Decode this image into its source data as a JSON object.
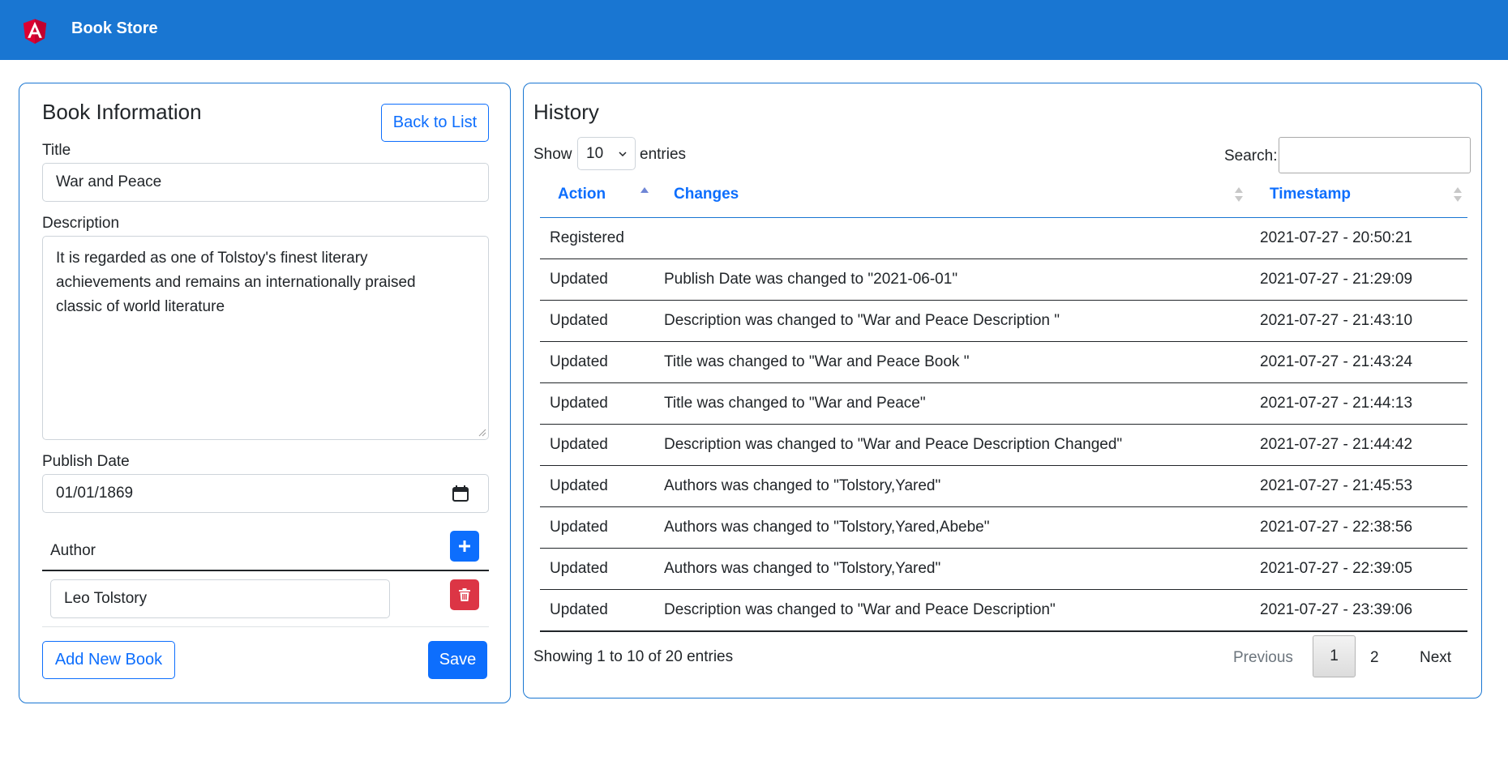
{
  "app": {
    "title": "Book Store"
  },
  "book_form": {
    "heading": "Book Information",
    "back_button": "Back to List",
    "title_label": "Title",
    "title_value": "War and Peace",
    "description_label": "Description",
    "description_value": "It is regarded as one of Tolstoy's finest literary\nachievements and remains an internationally praised\nclassic of world literature",
    "publish_date_label": "Publish Date",
    "publish_date_value": "01/01/1869",
    "author_header": "Author",
    "authors": [
      "Leo Tolstory"
    ],
    "add_new_button": "Add New Book",
    "save_button": "Save"
  },
  "history": {
    "heading": "History",
    "show_label": "Show",
    "entries_label": "entries",
    "page_size": "10",
    "search_label": "Search:",
    "search_value": "",
    "columns": [
      "Action",
      "Changes",
      "Timestamp"
    ],
    "rows": [
      {
        "action": "Registered",
        "changes": "",
        "timestamp": "2021-07-27 - 20:50:21"
      },
      {
        "action": "Updated",
        "changes": "Publish Date was changed to \"2021-06-01\"",
        "timestamp": "2021-07-27 - 21:29:09"
      },
      {
        "action": "Updated",
        "changes": "Description was changed to \"War and Peace Description \"",
        "timestamp": "2021-07-27 - 21:43:10"
      },
      {
        "action": "Updated",
        "changes": "Title was changed to \"War and Peace Book \"",
        "timestamp": "2021-07-27 - 21:43:24"
      },
      {
        "action": "Updated",
        "changes": "Title was changed to \"War and Peace\"",
        "timestamp": "2021-07-27 - 21:44:13"
      },
      {
        "action": "Updated",
        "changes": "Description was changed to \"War and Peace Description Changed\"",
        "timestamp": "2021-07-27 - 21:44:42"
      },
      {
        "action": "Updated",
        "changes": "Authors was changed to \"Tolstory,Yared\"",
        "timestamp": "2021-07-27 - 21:45:53"
      },
      {
        "action": "Updated",
        "changes": "Authors was changed to \"Tolstory,Yared,Abebe\"",
        "timestamp": "2021-07-27 - 22:38:56"
      },
      {
        "action": "Updated",
        "changes": "Authors was changed to \"Tolstory,Yared\"",
        "timestamp": "2021-07-27 - 22:39:05"
      },
      {
        "action": "Updated",
        "changes": "Description was changed to \"War and Peace Description\"",
        "timestamp": "2021-07-27 - 23:39:06"
      }
    ],
    "info": "Showing 1 to 10 of 20 entries",
    "pagination": {
      "previous": "Previous",
      "pages": [
        "1",
        "2"
      ],
      "current": "1",
      "next": "Next"
    }
  },
  "colors": {
    "header": "#1976d2",
    "primary": "#0d6efd",
    "danger": "#dc3545",
    "angular_red": "#dd0031"
  }
}
